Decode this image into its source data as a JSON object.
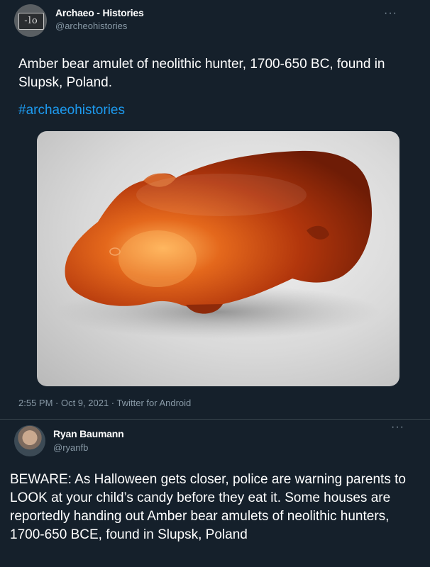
{
  "tweet1": {
    "avatar_icon": "archaeo-logo-icon",
    "avatar_text": "-lo",
    "name": "Archaeo - Histories",
    "handle": "@archeohistories",
    "more_icon": "more-dots-icon",
    "text": "Amber bear amulet of neolithic hunter, 1700-650 BC, found in Slupsk, Poland.",
    "hashtag": "#archaeohistories",
    "media_subject": "amber-bear-amulet-photo",
    "meta": "2:55 PM · Oct 9, 2021 · Twitter for Android"
  },
  "tweet2": {
    "avatar_icon": "user-avatar",
    "name": "Ryan Baumann",
    "handle": "@ryanfb",
    "more_icon": "more-dots-icon",
    "text": "BEWARE: As Halloween gets closer, police are warning parents to LOOK at your child’s candy before they eat it. Some houses are reportedly handing out Amber bear amulets of neolithic hunters, 1700-650 BCE, found in Slupsk, Poland"
  },
  "colors": {
    "background": "#15202b",
    "text_primary": "#ffffff",
    "text_secondary": "#8899a6",
    "link": "#1d9bf0",
    "amber": "#c9460f"
  }
}
